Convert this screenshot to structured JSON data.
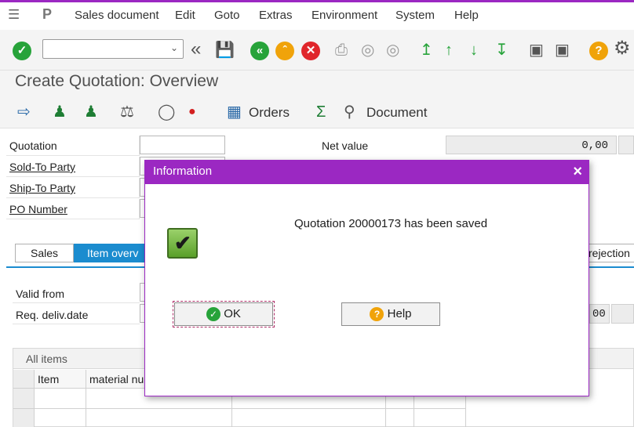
{
  "menubar": {
    "items": [
      "Sales document",
      "Edit",
      "Goto",
      "Extras",
      "Environment",
      "System",
      "Help"
    ]
  },
  "icons": {
    "menu": "menu-icon",
    "p": "sap-p-icon",
    "enter": "enter-check-icon",
    "back": "double-chevron-left-icon",
    "save": "save-icon",
    "help": "help-icon",
    "settings": "gear-icon"
  },
  "title": "Create Quotation: Overview",
  "apptoolbar": {
    "orders_label": "Orders",
    "document_label": "Document"
  },
  "header_form": {
    "quotation_label": "Quotation",
    "sold_to_label": "Sold-To Party",
    "ship_to_label": "Ship-To Party",
    "po_label": "PO Number",
    "net_value_label": "Net value",
    "net_value": "0,00",
    "req_deliv_value": "00"
  },
  "tabs": {
    "sales": "Sales",
    "item_overview": "Item overv",
    "rejection": "rejection"
  },
  "dates": {
    "valid_from_label": "Valid from",
    "req_deliv_label": "Req. deliv.date"
  },
  "grid": {
    "title": "All items",
    "columns": [
      "Item",
      "material nu"
    ]
  },
  "dialog": {
    "title": "Information",
    "message": "Quotation 20000173 has been saved",
    "ok_label": "OK",
    "help_label": "Help"
  },
  "colors": {
    "accent": "#9b28c2",
    "tab_active": "#1b8ccf",
    "check_green": "#27a33a",
    "help_orange": "#f0a30a",
    "cancel_red": "#e0262b"
  }
}
